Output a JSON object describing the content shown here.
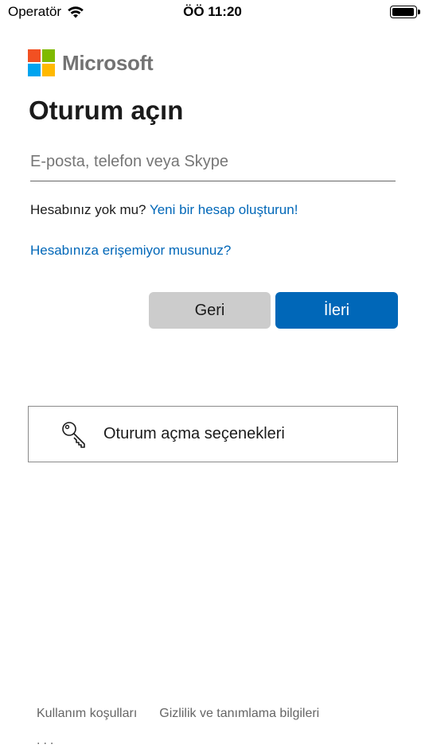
{
  "status_bar": {
    "carrier": "Operatör",
    "time": "ÖÖ 11:20",
    "battery_level": 0.95
  },
  "logo": {
    "text": "Microsoft",
    "colors": [
      "#f25022",
      "#7fba00",
      "#00a4ef",
      "#ffb900"
    ]
  },
  "title": "Oturum açın",
  "email_input": {
    "placeholder": "E-posta, telefon veya Skype",
    "value": ""
  },
  "no_account": {
    "text": "Hesabınız yok mu?",
    "link": "Yeni bir hesap oluşturun!"
  },
  "cant_access_link": "Hesabınıza erişemiyor musunuz?",
  "buttons": {
    "back": "Geri",
    "next": "İleri"
  },
  "signin_options": {
    "icon": "key-icon",
    "label": "Oturum açma seçenekleri"
  },
  "footer": {
    "terms": "Kullanım koşulları",
    "privacy": "Gizlilik ve tanımlama bilgileri",
    "more": "..."
  },
  "colors": {
    "accent": "#0067b8",
    "back_button": "#cccccc"
  }
}
